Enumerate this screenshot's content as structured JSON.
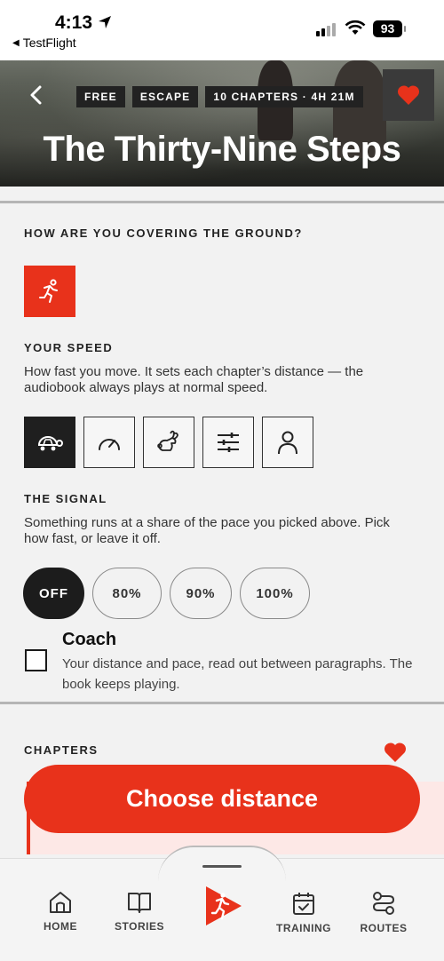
{
  "status": {
    "time": "4:13",
    "back_app": "TestFlight",
    "battery": "93"
  },
  "hero": {
    "tags": [
      "FREE",
      "ESCAPE",
      "10 CHAPTERS · 4H 21M"
    ],
    "title": "The Thirty-Nine Steps"
  },
  "ground": {
    "label": "HOW ARE YOU COVERING THE GROUND?",
    "selected_mode_icon": "running-person-icon"
  },
  "speed": {
    "label": "YOUR SPEED",
    "description": "How fast you move. It sets each chapter’s distance — the audiobook always plays at normal speed.",
    "options": [
      "turtle-icon",
      "speedometer-icon",
      "rabbit-icon",
      "sliders-icon",
      "person-icon"
    ],
    "selected_index": 0
  },
  "signal": {
    "label": "THE SIGNAL",
    "description": "Something runs at a share of the pace you picked above. Pick how fast, or leave it off.",
    "options": [
      "OFF",
      "80%",
      "90%",
      "100%"
    ],
    "selected": "OFF"
  },
  "coach": {
    "title": "Coach",
    "description": "Your distance and pace, read out between paragraphs. The book keeps playing.",
    "checked": false
  },
  "chapters": {
    "label": "CHAPTERS"
  },
  "cta": {
    "label": "Choose distance"
  },
  "nav": {
    "home": "HOME",
    "stories": "STORIES",
    "training": "TRAINING",
    "routes": "ROUTES"
  },
  "colors": {
    "accent": "#e8321b",
    "dark": "#1c1c1c"
  }
}
